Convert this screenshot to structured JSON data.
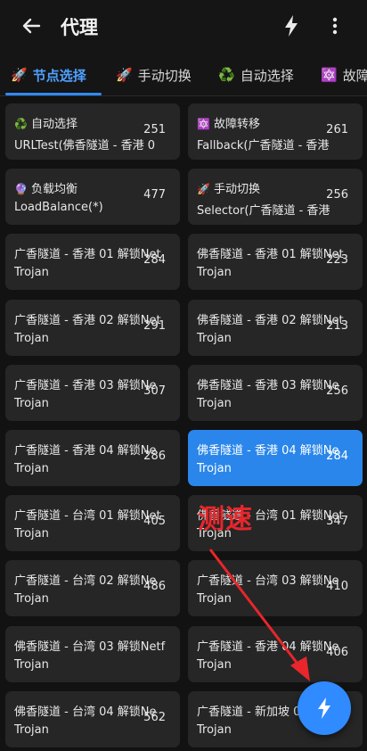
{
  "appbar": {
    "title": "代理",
    "back_icon": "back-arrow-icon",
    "speed_icon": "bolt-icon",
    "more_icon": "more-vertical-icon"
  },
  "tabs": [
    {
      "emoji": "🚀",
      "label": "节点选择",
      "active": true
    },
    {
      "emoji": "🚀",
      "label": "手动切换",
      "active": false
    },
    {
      "emoji": "♻️",
      "label": "自动选择",
      "active": false
    },
    {
      "emoji": "🔯",
      "label": "故障",
      "active": false
    }
  ],
  "cards": [
    {
      "emoji": "♻️",
      "line1": "自动选择",
      "line2": "URLTest(佛香隧道 - 香港 0",
      "delay": "251",
      "selected": false
    },
    {
      "emoji": "🔯",
      "line1": "故障转移",
      "line2": "Fallback(广香隧道 - 香港",
      "delay": "261",
      "selected": false
    },
    {
      "emoji": "🔮",
      "line1": "负载均衡",
      "line2": "LoadBalance(*)",
      "delay": "477",
      "selected": false
    },
    {
      "emoji": "🚀",
      "line1": "手动切换",
      "line2": "Selector(广香隧道 - 香港",
      "delay": "256",
      "selected": false
    },
    {
      "emoji": "",
      "line1": "广香隧道 - 香港 01 解锁Net",
      "line2": "Trojan",
      "delay": "284",
      "selected": false
    },
    {
      "emoji": "",
      "line1": "佛香隧道 - 香港 01 解锁Net",
      "line2": "Trojan",
      "delay": "223",
      "selected": false
    },
    {
      "emoji": "",
      "line1": "广香隧道 - 香港 02 解锁Net",
      "line2": "Trojan",
      "delay": "291",
      "selected": false
    },
    {
      "emoji": "",
      "line1": "佛香隧道 - 香港 02 解锁Net",
      "line2": "Trojan",
      "delay": "213",
      "selected": false
    },
    {
      "emoji": "",
      "line1": "广香隧道 - 香港 03 解锁Ne",
      "line2": "Trojan",
      "delay": "307",
      "selected": false
    },
    {
      "emoji": "",
      "line1": "佛香隧道 - 香港 03 解锁Ne",
      "line2": "Trojan",
      "delay": "256",
      "selected": false
    },
    {
      "emoji": "",
      "line1": "广香隧道 - 香港 04 解锁Ne",
      "line2": "Trojan",
      "delay": "286",
      "selected": false
    },
    {
      "emoji": "",
      "line1": "佛香隧道 - 香港 04 解锁Ne",
      "line2": "Trojan",
      "delay": "284",
      "selected": true
    },
    {
      "emoji": "",
      "line1": "广香隧道 - 台湾 01 解锁Net",
      "line2": "Trojan",
      "delay": "405",
      "selected": false
    },
    {
      "emoji": "",
      "line1": "佛香隧道 - 台湾 01 解锁Net",
      "line2": "Trojan",
      "delay": "347",
      "selected": false
    },
    {
      "emoji": "",
      "line1": "广香隧道 - 台湾 02 解锁Ne",
      "line2": "Trojan",
      "delay": "486",
      "selected": false
    },
    {
      "emoji": "",
      "line1": "广香隧道 - 台湾 03 解锁Ne",
      "line2": "Trojan",
      "delay": "410",
      "selected": false
    },
    {
      "emoji": "",
      "line1": "佛香隧道 - 台湾 03 解锁Netf",
      "line2": "Trojan",
      "delay": "",
      "selected": false
    },
    {
      "emoji": "",
      "line1": "广香隧道 - 香港 04 解锁Ne",
      "line2": "Trojan",
      "delay": "406",
      "selected": false
    },
    {
      "emoji": "",
      "line1": "佛香隧道 - 台湾 04 解锁Ne",
      "line2": "Trojan",
      "delay": "562",
      "selected": false
    },
    {
      "emoji": "",
      "line1": "广香隧道 - 新加坡 0",
      "line2": "Trojan",
      "delay": "",
      "selected": false
    }
  ],
  "annotation": {
    "text": "测速",
    "color": "#e8262b"
  },
  "fab": {
    "icon": "bolt-icon"
  },
  "colors": {
    "accent": "#2f8bff",
    "card": "#262626",
    "selected_card": "#2a86ea",
    "background": "#121212"
  }
}
